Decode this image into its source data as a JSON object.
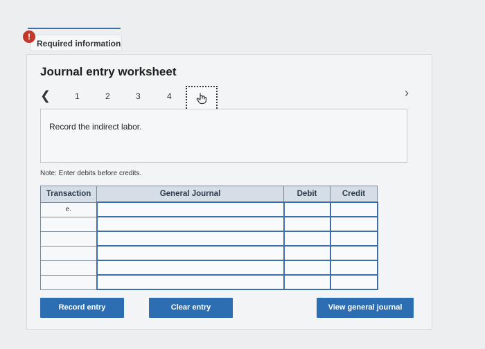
{
  "alert": {
    "icon": "exclamation-icon",
    "glyph": "!",
    "label": "Required information"
  },
  "worksheet": {
    "title": "Journal entry worksheet",
    "pages": [
      "1",
      "2",
      "3",
      "4"
    ],
    "current_page": 5,
    "instruction": "Record the indirect labor.",
    "note": "Note: Enter debits before credits."
  },
  "journal": {
    "headers": {
      "transaction": "Transaction",
      "general_journal": "General Journal",
      "debit": "Debit",
      "credit": "Credit"
    },
    "rows": [
      {
        "transaction": "e.",
        "account": "",
        "debit": "",
        "credit": ""
      },
      {
        "transaction": "",
        "account": "",
        "debit": "",
        "credit": ""
      },
      {
        "transaction": "",
        "account": "",
        "debit": "",
        "credit": ""
      },
      {
        "transaction": "",
        "account": "",
        "debit": "",
        "credit": ""
      },
      {
        "transaction": "",
        "account": "",
        "debit": "",
        "credit": ""
      },
      {
        "transaction": "",
        "account": "",
        "debit": "",
        "credit": ""
      }
    ]
  },
  "buttons": {
    "record": "Record entry",
    "clear": "Clear entry",
    "view": "View general journal"
  },
  "colors": {
    "accent": "#2d6eb3",
    "header_bg": "#d5dde6",
    "alert": "#c0392b"
  }
}
